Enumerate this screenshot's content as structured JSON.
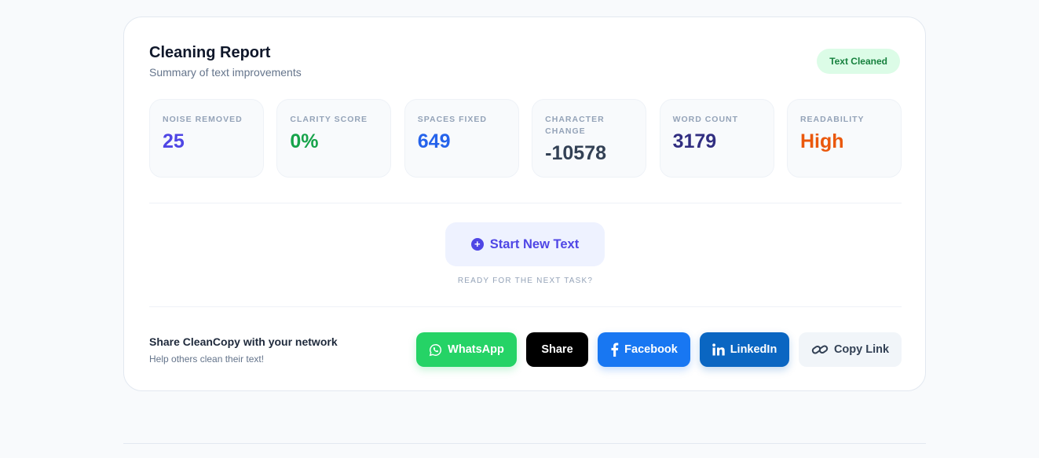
{
  "report": {
    "title": "Cleaning Report",
    "subtitle": "Summary of text improvements",
    "badge": "Text Cleaned"
  },
  "stats": [
    {
      "label": "NOISE REMOVED",
      "value": "25",
      "color": "#4f46e5"
    },
    {
      "label": "CLARITY SCORE",
      "value": "0%",
      "color": "#16a34a"
    },
    {
      "label": "SPACES FIXED",
      "value": "649",
      "color": "#2563eb"
    },
    {
      "label": "CHARACTER CHANGE",
      "value": "-10578",
      "color": "#334155"
    },
    {
      "label": "WORD COUNT",
      "value": "3179",
      "color": "#312e81"
    },
    {
      "label": "READABILITY",
      "value": "High",
      "color": "#ea580c"
    }
  ],
  "actions": {
    "start_new": "Start New Text",
    "start_new_icon": "plus-circle-icon",
    "ready_caption": "READY FOR THE NEXT TASK?"
  },
  "share": {
    "title": "Share CleanCopy with your network",
    "subtitle": "Help others clean their text!",
    "buttons": {
      "whatsapp": "WhatsApp",
      "x": "Share",
      "facebook": "Facebook",
      "linkedin": "LinkedIn",
      "copy": "Copy Link"
    },
    "colors": {
      "whatsapp": "#25d366",
      "x": "#000000",
      "facebook": "#1877f2",
      "linkedin": "#0a66c2"
    }
  }
}
